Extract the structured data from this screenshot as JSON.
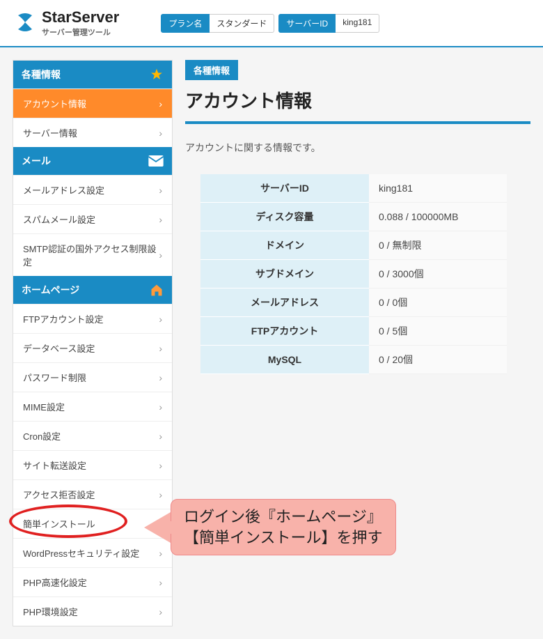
{
  "header": {
    "logo_main": "StarServer",
    "logo_sub": "サーバー管理ツール",
    "plan_label": "プラン名",
    "plan_value": "スタンダード",
    "server_id_label": "サーバーID",
    "server_id_value": "king181"
  },
  "sidebar": {
    "sections": [
      {
        "title": "各種情報",
        "icon": "star",
        "items": [
          {
            "label": "アカウント情報",
            "active": true
          },
          {
            "label": "サーバー情報"
          }
        ]
      },
      {
        "title": "メール",
        "icon": "mail",
        "items": [
          {
            "label": "メールアドレス設定"
          },
          {
            "label": "スパムメール設定"
          },
          {
            "label": "SMTP認証の国外アクセス制限設定"
          }
        ]
      },
      {
        "title": "ホームページ",
        "icon": "home",
        "items": [
          {
            "label": "FTPアカウント設定"
          },
          {
            "label": "データベース設定"
          },
          {
            "label": "パスワード制限"
          },
          {
            "label": "MIME設定"
          },
          {
            "label": "Cron設定"
          },
          {
            "label": "サイト転送設定"
          },
          {
            "label": "アクセス拒否設定"
          },
          {
            "label": "簡単インストール"
          },
          {
            "label": "WordPressセキュリティ設定"
          },
          {
            "label": "PHP高速化設定"
          },
          {
            "label": "PHP環境設定"
          }
        ]
      }
    ]
  },
  "content": {
    "badge": "各種情報",
    "title": "アカウント情報",
    "desc": "アカウントに関する情報です。",
    "table": [
      {
        "label": "サーバーID",
        "value": "king181"
      },
      {
        "label": "ディスク容量",
        "value": "0.088 / 100000MB"
      },
      {
        "label": "ドメイン",
        "value": "0 / 無制限"
      },
      {
        "label": "サブドメイン",
        "value": "0 / 3000個"
      },
      {
        "label": "メールアドレス",
        "value": "0 / 0個"
      },
      {
        "label": "FTPアカウント",
        "value": "0 / 5個"
      },
      {
        "label": "MySQL",
        "value": "0 / 20個"
      }
    ]
  },
  "annotation": {
    "line1": "ログイン後『ホームページ』",
    "line2": "【簡単インストール】を押す"
  },
  "colors": {
    "primary": "#1a8bc4",
    "accent": "#ff8a2a"
  }
}
